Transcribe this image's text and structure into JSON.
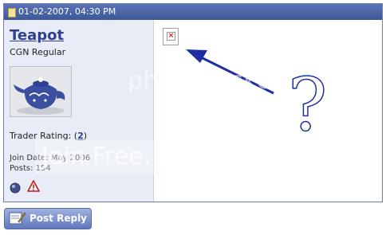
{
  "post": {
    "date": "01-02-2007, 04:30 PM",
    "user": {
      "name": "Teapot",
      "title": "CGN Regular",
      "trader_rating_label": "Trader Rating: (",
      "trader_rating_value": "2",
      "trader_rating_suffix": ")",
      "join_date": "Join Date: May 2006",
      "posts": "Posts: 154"
    }
  },
  "watermark": {
    "line1": "photobucket",
    "line2": "Join Free. Share privately."
  },
  "actions": {
    "reply_label": "Post Reply"
  },
  "icons": {
    "date": "document-icon",
    "online": "online-status-icon",
    "report": "report-post-icon",
    "broken": "broken-image-icon",
    "reply": "pen-icon"
  },
  "colors": {
    "header_bg": "#4a65a7",
    "link": "#2f3f8f",
    "arrow": "#1f2fa0"
  }
}
